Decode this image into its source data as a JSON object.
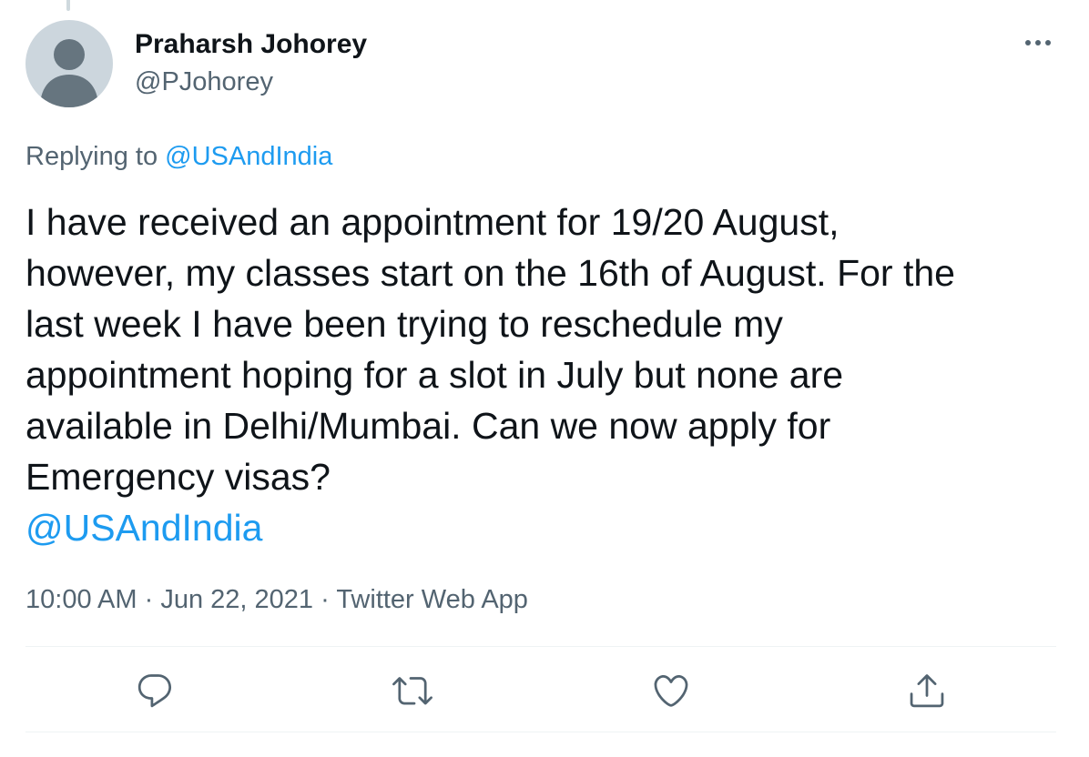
{
  "author": {
    "display_name": "Praharsh Johorey",
    "handle": "@PJohorey"
  },
  "reply_context": {
    "prefix": "Replying to",
    "mention": "@USAndIndia"
  },
  "tweet": {
    "lines": [
      "I have received an appointment for 19/20 August,",
      "however, my classes start on the 16th of August. For the",
      "last week I have been trying to reschedule my",
      "appointment hoping for a slot in July but none are",
      "available in Delhi/Mumbai. Can we now apply for",
      "Emergency visas?"
    ],
    "mention": "@USAndIndia"
  },
  "meta": {
    "time": "10:00 AM",
    "separator": "·",
    "date": "Jun 22, 2021",
    "source": "Twitter Web App"
  },
  "actions": {
    "reply_icon": "reply-icon",
    "retweet_icon": "retweet-icon",
    "like_icon": "heart-icon",
    "share_icon": "share-icon"
  },
  "colors": {
    "link": "#1d9bf0",
    "text": "#0f1419",
    "secondary": "#536471",
    "divider": "#eff3f4",
    "avatar_bg": "#ccd6dd",
    "avatar_figure": "#66757f"
  },
  "menu_icon": "more-horizontal-icon"
}
